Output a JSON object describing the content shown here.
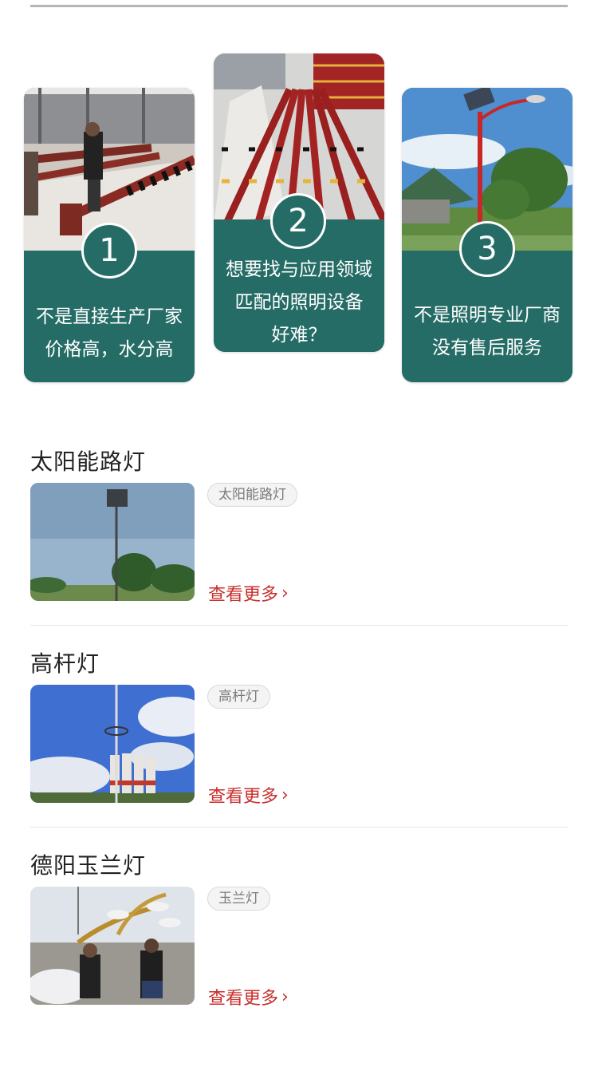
{
  "cards": [
    {
      "number": "1",
      "lines": [
        "不是直接生产厂家",
        "价格高，水分高"
      ]
    },
    {
      "number": "2",
      "lines": [
        "想要找与应用领域",
        "匹配的照明设备",
        "好难？"
      ]
    },
    {
      "number": "3",
      "lines": [
        "不是照明专业厂商",
        "没有售后服务"
      ]
    }
  ],
  "sections": [
    {
      "title": "太阳能路灯",
      "tag": "太阳能路灯",
      "more": "查看更多",
      "more_icon": "chevron-right-icon"
    },
    {
      "title": "高杆灯",
      "tag": "高杆灯",
      "more": "查看更多",
      "more_icon": "chevron-right-icon"
    },
    {
      "title": "德阳玉兰灯",
      "tag": "玉兰灯",
      "more": "查看更多",
      "more_icon": "chevron-right-icon"
    }
  ],
  "colors": {
    "card_panel": "#256c66",
    "more_link": "#c8302d",
    "tag_border": "#d9d9d9",
    "divider": "#e6e6e6"
  }
}
